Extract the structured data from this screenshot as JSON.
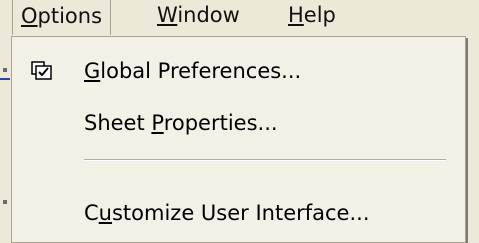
{
  "menubar": {
    "items": [
      {
        "label": "Options",
        "mnemonic": "O",
        "rest": "ptions",
        "active": true
      },
      {
        "label": "Window",
        "mnemonic": "W",
        "rest": "indow"
      },
      {
        "label": "Help",
        "mnemonic": "H",
        "rest": "elp"
      }
    ]
  },
  "menu": {
    "items": [
      {
        "label": "Global Preferences...",
        "mnemonic": "G",
        "rest": "lobal Preferences...",
        "icon": "checked-pages-icon"
      },
      {
        "label": "Sheet Properties...",
        "pre": "Sheet ",
        "mnemonic": "P",
        "rest": "roperties..."
      },
      {
        "label": "Customize User Interface...",
        "pre": "C",
        "mnemonic": "u",
        "rest": "stomize User Interface..."
      }
    ]
  },
  "colors": {
    "menu_bg": "#f3f1e6",
    "bar_bg": "#ece9d8",
    "border": "#a7a592"
  }
}
